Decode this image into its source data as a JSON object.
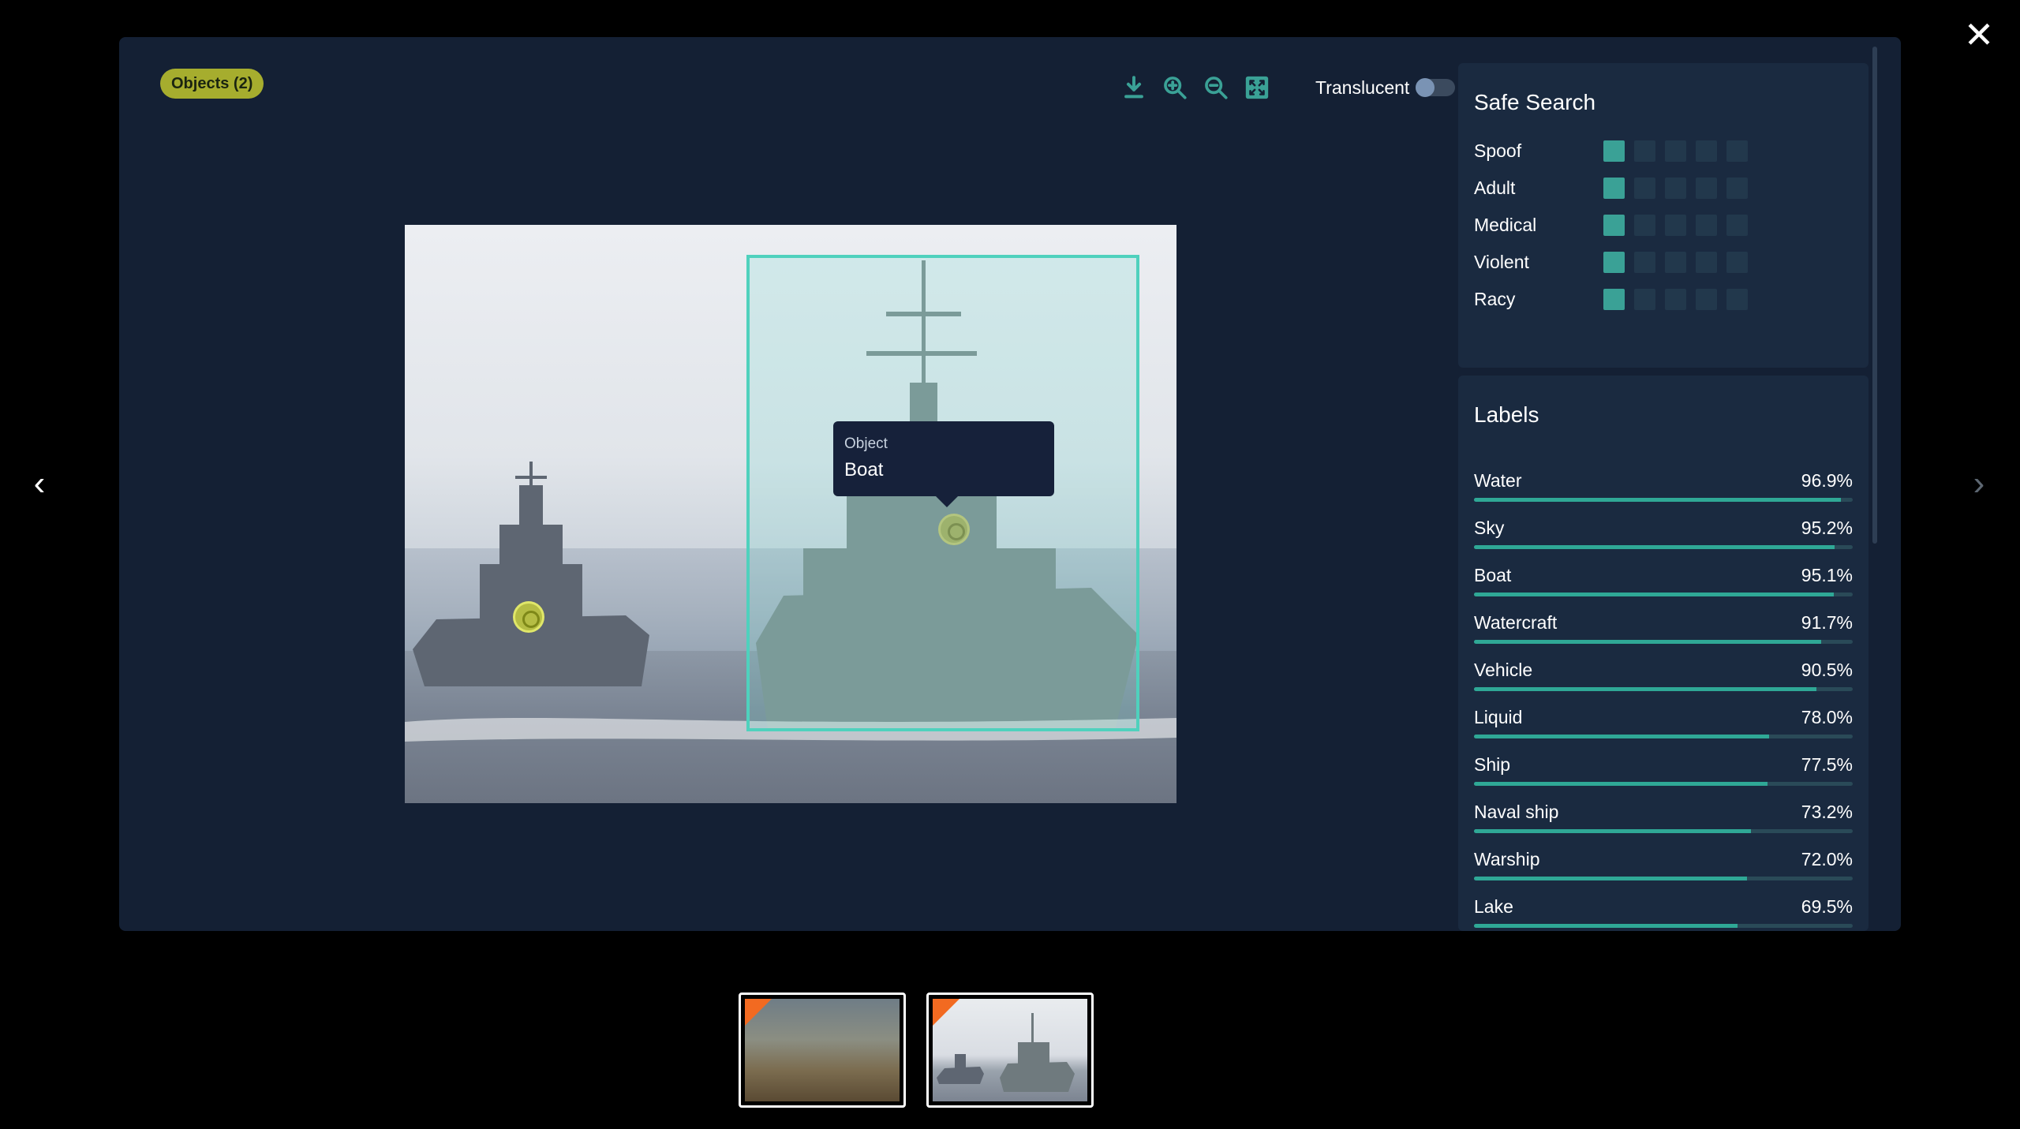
{
  "objects_badge": "Objects (2)",
  "toolbar": {
    "download_icon": "download-icon",
    "zoom_in_icon": "zoom-in-icon",
    "zoom_out_icon": "zoom-out-icon",
    "fit_icon": "fit-screen-icon",
    "translucent_label": "Translucent",
    "translucent_on": false
  },
  "tooltip": {
    "kind": "Object",
    "value": "Boat"
  },
  "safe_search": {
    "title": "Safe Search",
    "rows": [
      {
        "label": "Spoof",
        "level": 1
      },
      {
        "label": "Adult",
        "level": 1
      },
      {
        "label": "Medical",
        "level": 1
      },
      {
        "label": "Violent",
        "level": 1
      },
      {
        "label": "Racy",
        "level": 1
      }
    ],
    "max_level": 5
  },
  "labels": {
    "title": "Labels",
    "items": [
      {
        "name": "Water",
        "score": "96.9%",
        "value": 96.9
      },
      {
        "name": "Sky",
        "score": "95.2%",
        "value": 95.2
      },
      {
        "name": "Boat",
        "score": "95.1%",
        "value": 95.1
      },
      {
        "name": "Watercraft",
        "score": "91.7%",
        "value": 91.7
      },
      {
        "name": "Vehicle",
        "score": "90.5%",
        "value": 90.5
      },
      {
        "name": "Liquid",
        "score": "78.0%",
        "value": 78.0
      },
      {
        "name": "Ship",
        "score": "77.5%",
        "value": 77.5
      },
      {
        "name": "Naval ship",
        "score": "73.2%",
        "value": 73.2
      },
      {
        "name": "Warship",
        "score": "72.0%",
        "value": 72.0
      },
      {
        "name": "Lake",
        "score": "69.5%",
        "value": 69.5
      }
    ]
  },
  "colors": {
    "accent": "#3aa196",
    "bbox": "#4fd1bd",
    "badge": "#a6ad2e",
    "thumb_flag": "#f26a21"
  },
  "icons": {
    "close": "close-icon",
    "prev": "chevron-left-icon",
    "next": "chevron-right-icon"
  }
}
